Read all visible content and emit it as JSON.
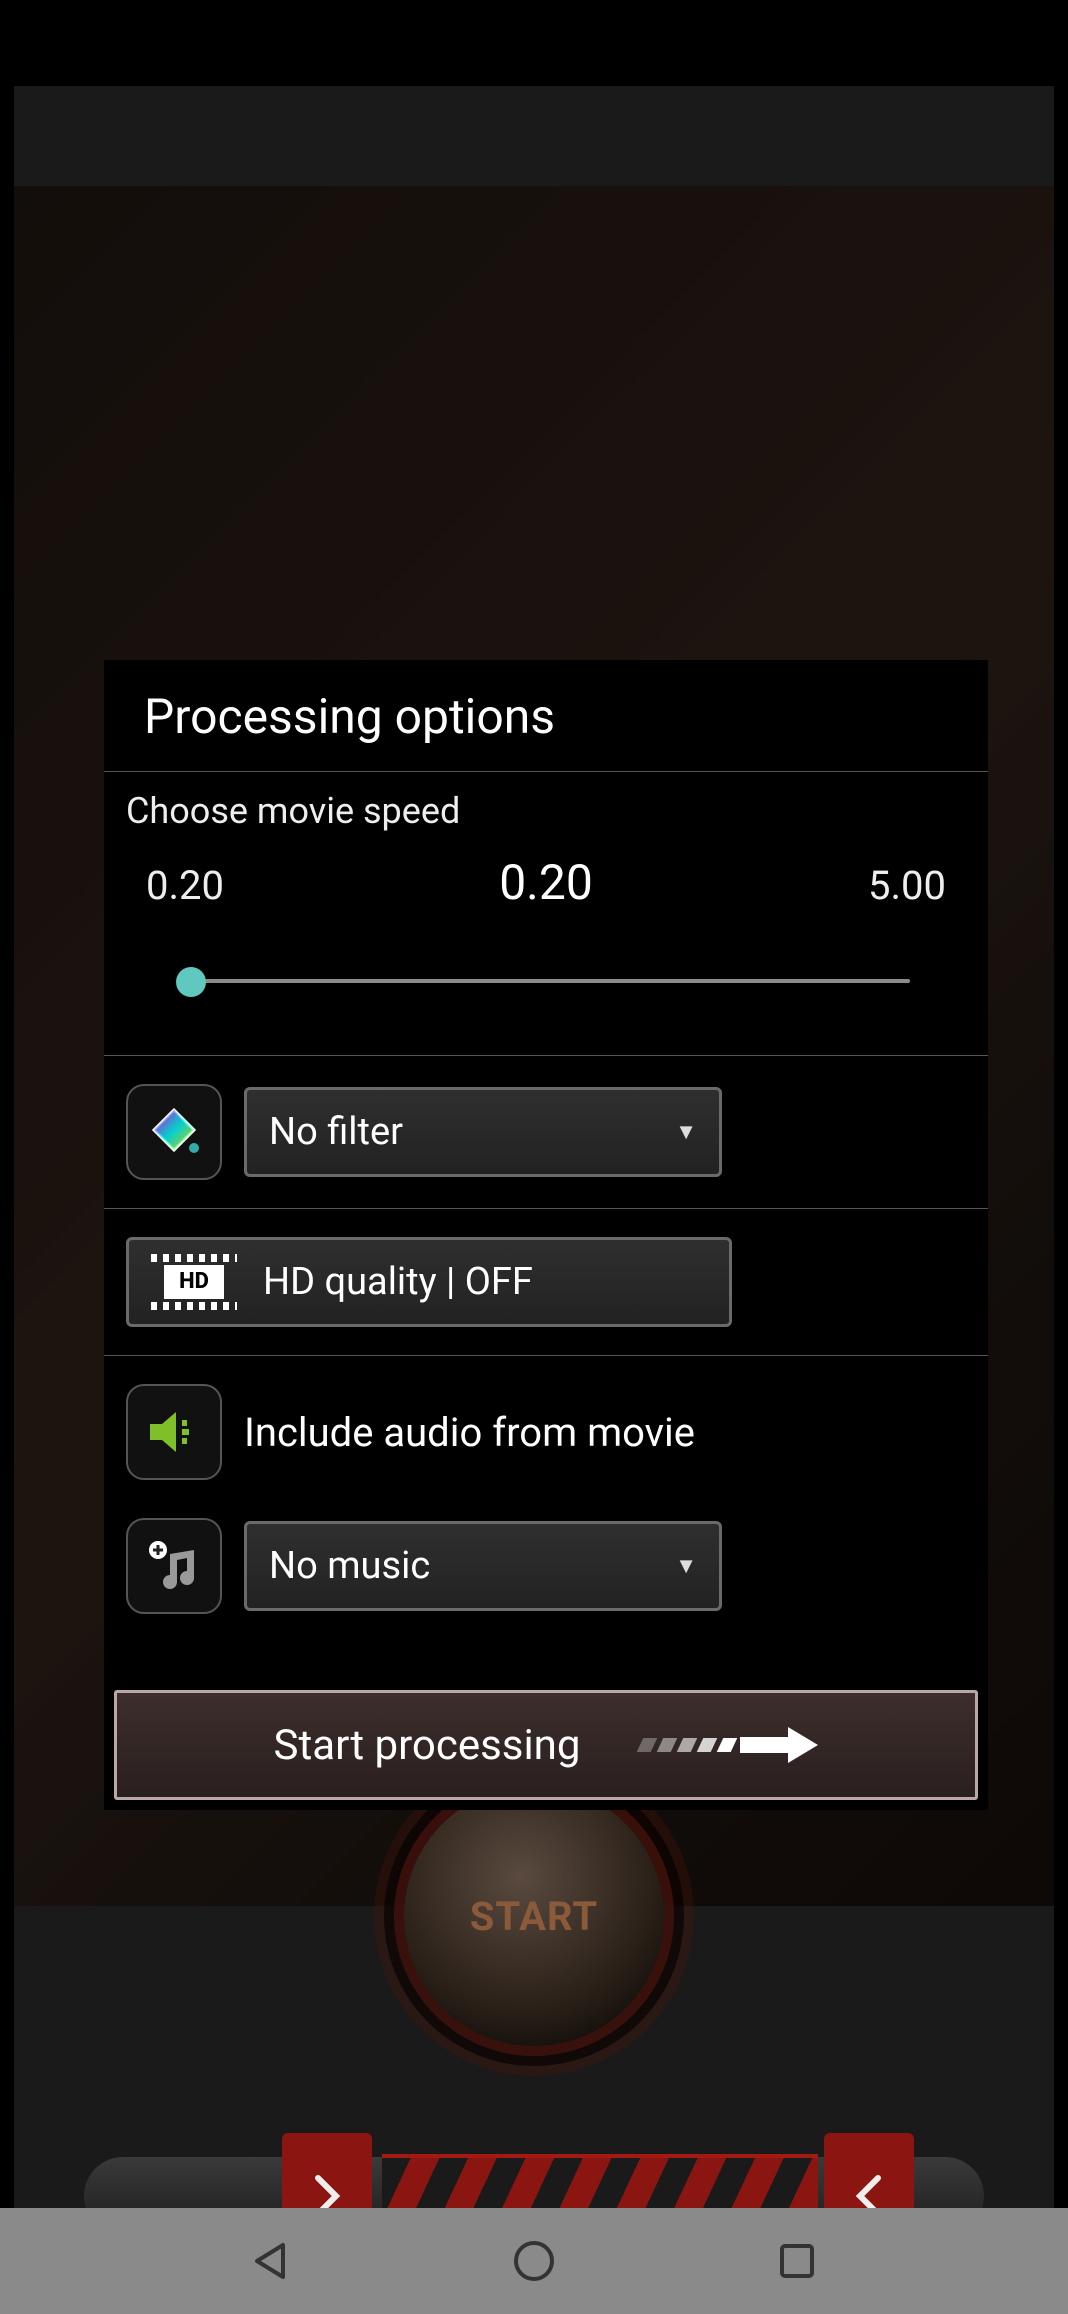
{
  "dialog": {
    "title": "Processing options",
    "speed": {
      "label": "Choose movie speed",
      "min": "0.20",
      "max": "5.00",
      "current": "0.20"
    },
    "filter": {
      "selected": "No filter"
    },
    "hd": {
      "label": "HD quality | OFF"
    },
    "audio": {
      "includeLabel": "Include audio from movie"
    },
    "music": {
      "selected": "No music"
    },
    "startButton": "Start processing"
  },
  "background": {
    "startButtonLabel": "START"
  }
}
